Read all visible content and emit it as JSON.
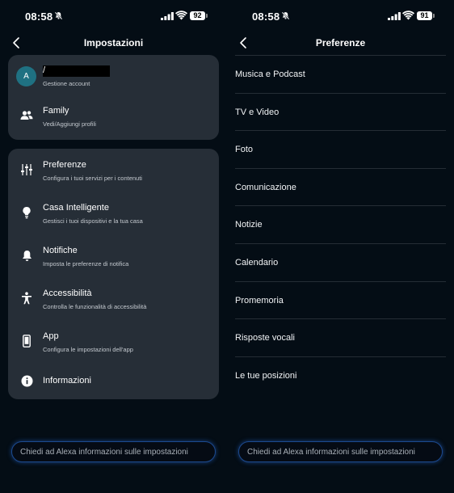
{
  "left": {
    "status": {
      "time": "08:58",
      "battery": "92"
    },
    "header": {
      "title": "Impostazioni"
    },
    "account": {
      "avatar_letter": "A",
      "name": "/",
      "subtitle": "Gestione account"
    },
    "family": {
      "label": "Family",
      "subtitle": "Vedi/Aggiungi profili"
    },
    "items": [
      {
        "label": "Preferenze",
        "subtitle": "Configura i tuoi servizi per i contenuti",
        "icon": "sliders-icon"
      },
      {
        "label": "Casa Intelligente",
        "subtitle": "Gestisci i tuoi dispositivi e la tua casa",
        "icon": "lightbulb-icon"
      },
      {
        "label": "Notifiche",
        "subtitle": "Imposta le preferenze di notifica",
        "icon": "bell-icon"
      },
      {
        "label": "Accessibilità",
        "subtitle": "Controlla le funzionalità di accessibilità",
        "icon": "accessibility-icon"
      },
      {
        "label": "App",
        "subtitle": "Configura le impostazioni dell'app",
        "icon": "phone-icon"
      },
      {
        "label": "Informazioni",
        "subtitle": "",
        "icon": "info-icon"
      }
    ],
    "ask_placeholder": "Chiedi ad Alexa informazioni sulle impostazioni"
  },
  "right": {
    "status": {
      "time": "08:58",
      "battery": "91"
    },
    "header": {
      "title": "Preferenze"
    },
    "items": [
      "Musica e Podcast",
      "TV e Video",
      "Foto",
      "Comunicazione",
      "Notizie",
      "Calendario",
      "Promemoria",
      "Risposte vocali",
      "Le tue posizioni"
    ],
    "ask_placeholder": "Chiedi ad Alexa informazioni sulle impostazioni"
  }
}
